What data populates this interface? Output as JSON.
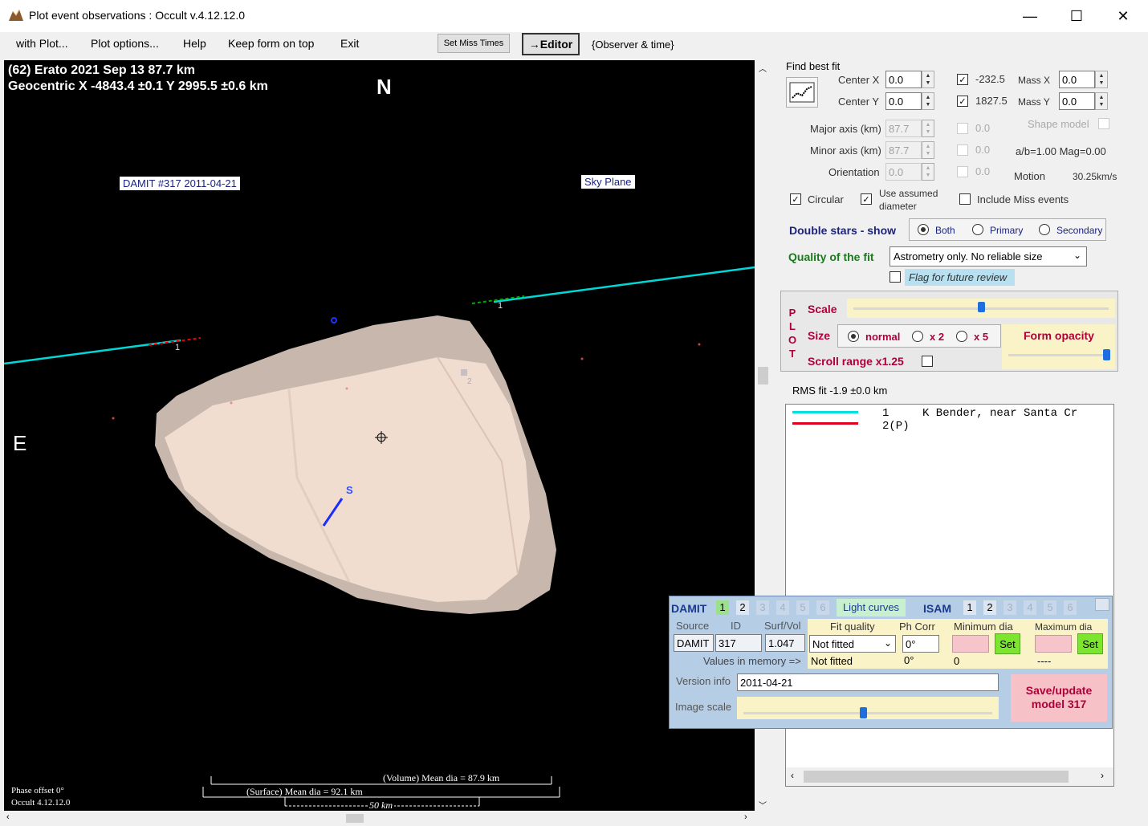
{
  "window": {
    "title": "Plot event observations : Occult v.4.12.12.0",
    "minimize": "—",
    "maximize": "☐",
    "close": "✕"
  },
  "menu": {
    "with_plot": "with Plot...",
    "plot_options": "Plot options...",
    "help": "Help",
    "keep_top": "Keep form on top",
    "exit": "Exit",
    "set_miss": "Set Miss Times",
    "editor": "→Editor",
    "observer_time": "{Observer & time}"
  },
  "plot": {
    "title1": "(62) Erato  2021 Sep 13   87.7 km",
    "title2": "Geocentric X  -4843.4 ±0.1  Y 2995.5 ±0.6 km",
    "north": "N",
    "east": "E",
    "south": "S",
    "damit_label": "DAMIT #317 2011-04-21",
    "sky_plane": "Sky Plane",
    "chord_label_1": "1",
    "chord_label_2": "1",
    "marker_2": "2",
    "volume_dia": "(Volume) Mean dia = 87.9 km",
    "surface_dia": "(Surface) Mean dia = 92.1 km",
    "scale_bar": "50 km",
    "phase_offset": "Phase offset 0°",
    "version": "Occult 4.12.12.0",
    "colors": {
      "chord": "#00d8d8",
      "body": "#e8d2c4",
      "background": "#000000"
    }
  },
  "fit": {
    "find_best_fit": "Find best fit",
    "center_x_label": "Center X",
    "center_x": "0.0",
    "center_y_label": "Center Y",
    "center_y": "0.0",
    "val_x": "-232.5",
    "val_y": "1827.5",
    "mass_x_label": "Mass X",
    "mass_x": "0.0",
    "mass_y_label": "Mass Y",
    "mass_y": "0.0",
    "major_axis_label": "Major axis (km)",
    "major_axis": "87.7",
    "minor_axis_label": "Minor axis (km)",
    "minor_axis": "87.7",
    "orientation_label": "Orientation",
    "orientation": "0.0",
    "zero_1": "0.0",
    "zero_2": "0.0",
    "zero_3": "0.0",
    "shape_model": "Shape model",
    "ab_mag": "a/b=1.00  Mag=0.00",
    "motion_label": "Motion",
    "motion": "30.25km/s",
    "circular": "Circular",
    "use_assumed": "Use assumed",
    "diameter": "diameter",
    "include_miss": "Include Miss events",
    "double_stars": "Double stars - show",
    "both": "Both",
    "primary": "Primary",
    "secondary": "Secondary",
    "quality_label": "Quality of the fit",
    "quality_value": "Astrometry only. No reliable size",
    "flag_review": "Flag for future review"
  },
  "plotpanel": {
    "plot_letters": [
      "P",
      "L",
      "O",
      "T"
    ],
    "scale": "Scale",
    "size": "Size",
    "normal": "normal",
    "x2": "x 2",
    "x5": "x 5",
    "form_opacity": "Form opacity",
    "scroll_range": "Scroll range x1.25",
    "scale_level": 0.5,
    "opacity_level": 1.0
  },
  "rms": "RMS fit  -1.9 ±0.0 km",
  "legend": {
    "row1_num": "1",
    "row1_text": "K Bender, near Santa Cr",
    "row2_num": "2(P)"
  },
  "damit": {
    "label": "DAMIT",
    "nums": [
      "1",
      "2",
      "3",
      "4",
      "5",
      "6"
    ],
    "light_curves": "Light curves",
    "isam": "ISAM",
    "isam_nums": [
      "1",
      "2",
      "3",
      "4",
      "5",
      "6"
    ],
    "source_h": "Source",
    "id_h": "ID",
    "surf_h": "Surf/Vol",
    "source": "DAMIT",
    "id": "317",
    "surf": "1.047",
    "fit_quality_h": "Fit quality",
    "ph_corr_h": "Ph Corr",
    "min_dia_h": "Minimum dia",
    "max_dia_h": "Maximum dia",
    "fit_quality": "Not fitted",
    "ph_corr": "0°",
    "set": "Set",
    "values_in_memory": "Values in memory =>",
    "mem_fit": "Not fitted",
    "mem_ph": "0°",
    "mem_min": "0",
    "mem_max": "----",
    "version_label": "Version info",
    "version": "2011-04-21",
    "image_scale": "Image scale",
    "image_scale_level": 0.48,
    "save": "Save/update model 317"
  }
}
